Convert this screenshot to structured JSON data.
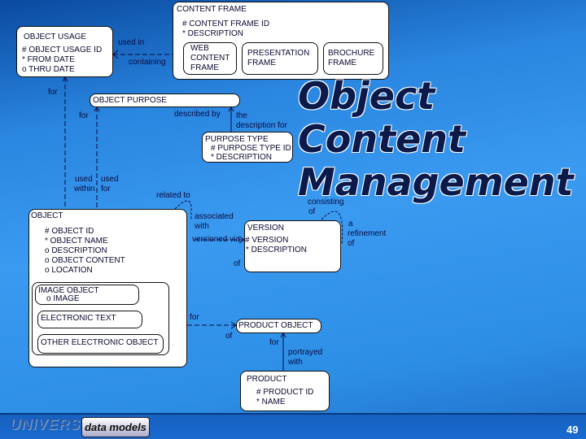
{
  "title": [
    "Object",
    "Content",
    "Management"
  ],
  "entities": {
    "content_frame": {
      "name": "CONTENT FRAME",
      "attrs": [
        "# CONTENT FRAME ID",
        "* DESCRIPTION"
      ],
      "subtypes": [
        [
          "WEB",
          "CONTENT",
          "FRAME"
        ],
        [
          "PRESENTATION",
          "FRAME"
        ],
        [
          "BROCHURE",
          "FRAME"
        ]
      ]
    },
    "object_usage": {
      "name": "OBJECT USAGE",
      "attrs": [
        "# OBJECT USAGE ID",
        "* FROM DATE",
        "o THRU DATE"
      ]
    },
    "object_purpose": {
      "name": "OBJECT PURPOSE"
    },
    "purpose_type": {
      "name": "PURPOSE TYPE",
      "attrs": [
        "# PURPOSE TYPE ID",
        "* DESCRIPTION"
      ]
    },
    "object": {
      "name": "OBJECT",
      "attrs": [
        "# OBJECT ID",
        "* OBJECT NAME",
        "o DESCRIPTION",
        "o OBJECT CONTENT",
        "o LOCATION"
      ],
      "subtypes": {
        "image_object": "IMAGE OBJECT",
        "image_attr": "o IMAGE",
        "electronic_text": "ELECTRONIC TEXT",
        "other": "OTHER ELECTRONIC OBJECT"
      }
    },
    "version": {
      "name": "VERSION",
      "attrs": [
        "# VERSION",
        "* DESCRIPTION"
      ]
    },
    "product_object": {
      "name": "PRODUCT OBJECT"
    },
    "product": {
      "name": "PRODUCT",
      "attrs": [
        "# PRODUCT ID",
        "* NAME"
      ]
    }
  },
  "labels": {
    "used_in": "used in",
    "containing": "containing",
    "for1": "for",
    "for2": "for",
    "described_by": "described by",
    "the": "the",
    "description_for": "description for",
    "used1": "used",
    "within": "within",
    "used2": "used",
    "for3": "for",
    "related_to": "related to",
    "associated": "associated",
    "with1": "with",
    "versioned_via": "versioned via",
    "of1": "of",
    "consisting": "consisting",
    "of2": "of",
    "a": "a",
    "refinement": "refinement",
    "of3": "of",
    "for4": "for",
    "of4": "of",
    "for5": "for",
    "portrayed": "portrayed",
    "with2": "with"
  },
  "footer": {
    "logo1": "UNIVERSAL",
    "logo2": "data models",
    "page": "49"
  }
}
